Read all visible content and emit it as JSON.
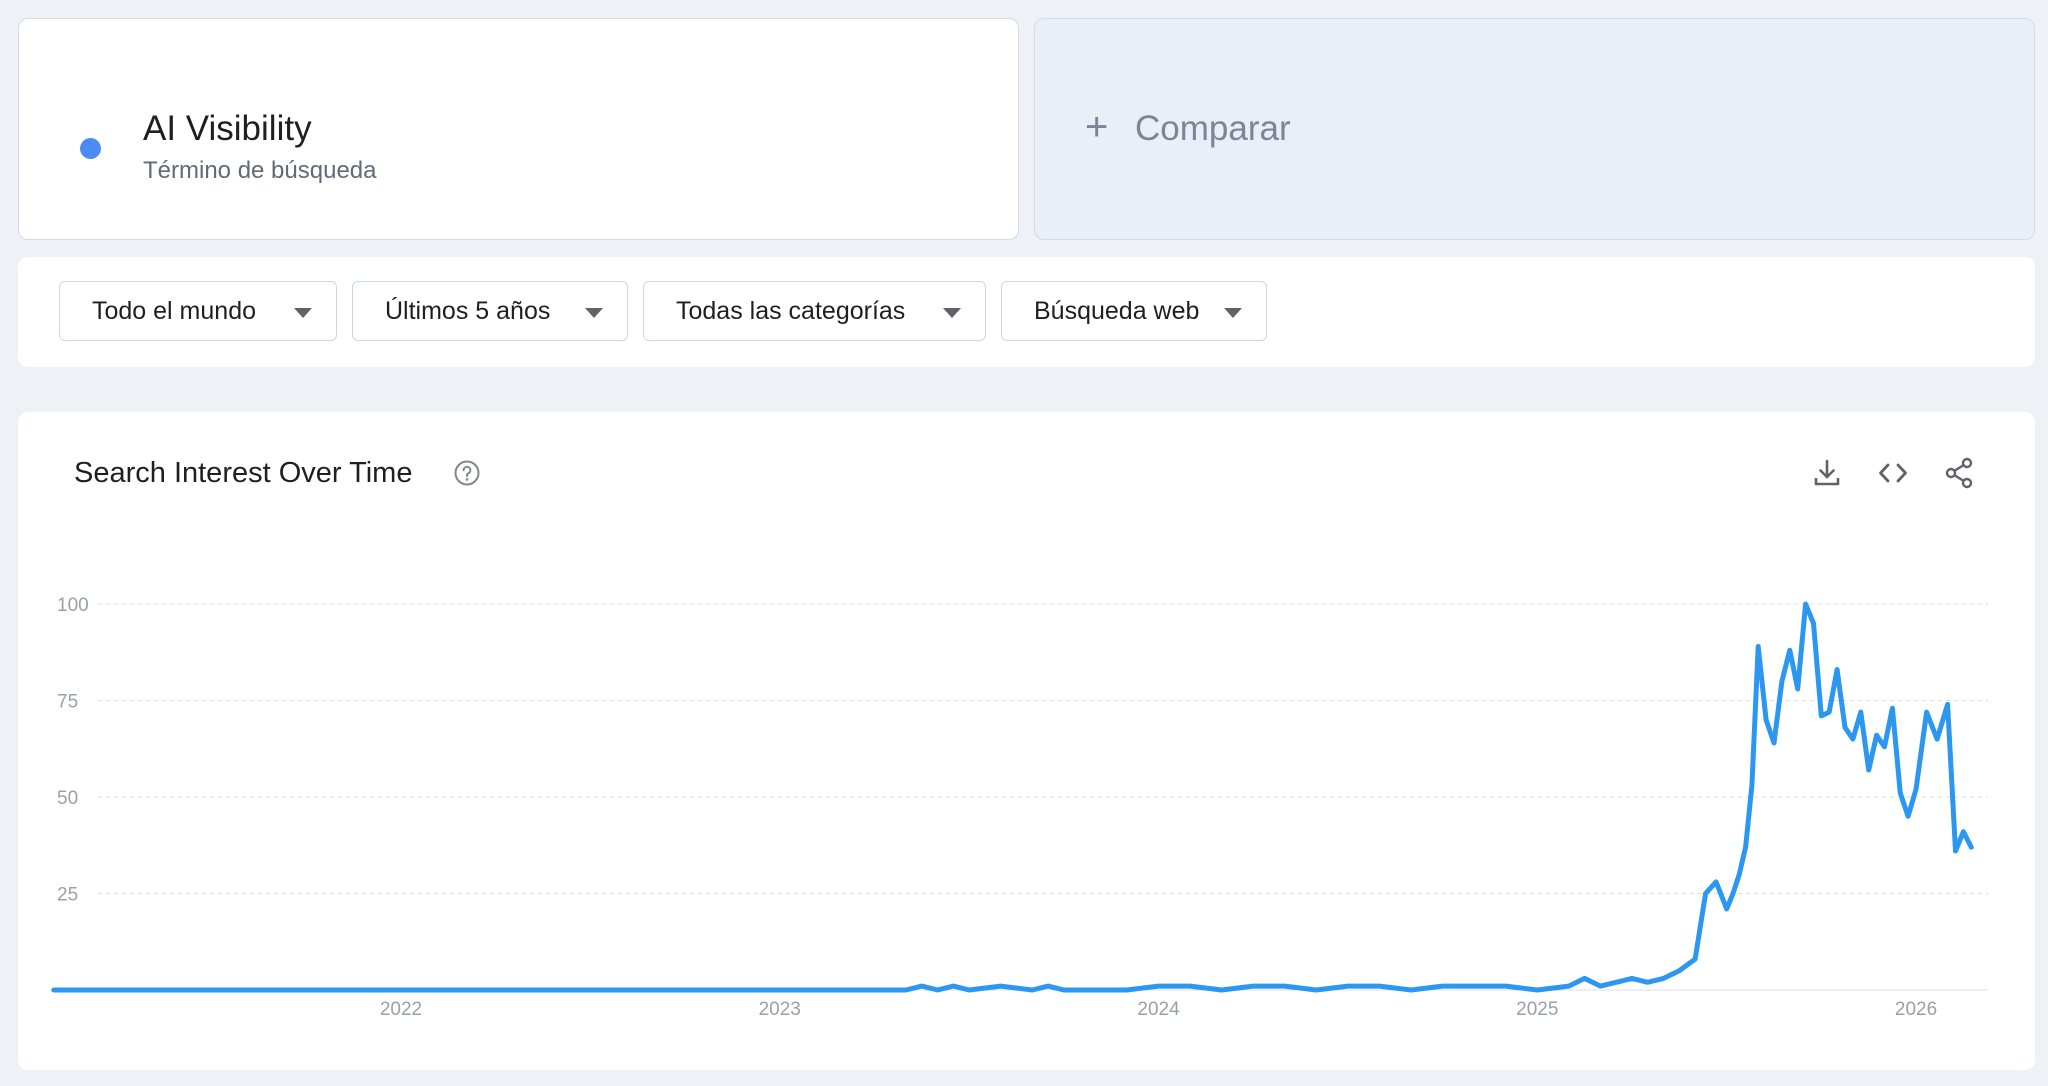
{
  "term": {
    "name": "AI Visibility",
    "subtitle": "Término de búsqueda",
    "color": "#4c8bf5"
  },
  "compare": {
    "plus": "+",
    "label": "Comparar"
  },
  "filters": [
    {
      "label": "Todo el mundo"
    },
    {
      "label": "Últimos 5 años"
    },
    {
      "label": "Todas las categorías"
    },
    {
      "label": "Búsqueda web"
    }
  ],
  "chart_card": {
    "title": "Search Interest Over Time",
    "help_icon": "help-circle-icon",
    "tools": [
      "download-icon",
      "embed-code-icon",
      "share-icon"
    ]
  },
  "chart_data": {
    "type": "line",
    "series": [
      {
        "color": "#2b97f0",
        "x": [
          "2021-02",
          "2021-06",
          "2022-01",
          "2022-06",
          "2023-01",
          "2023-05",
          "2023-05",
          "2023-06",
          "2023-06",
          "2023-07",
          "2023-08",
          "2023-09",
          "2023-09",
          "2023-10",
          "2023-12",
          "2024-01",
          "2024-01",
          "2024-02",
          "2024-03",
          "2024-04",
          "2024-05",
          "2024-06",
          "2024-07",
          "2024-08",
          "2024-09",
          "2024-10",
          "2024-11",
          "2024-12",
          "2025-01",
          "2025-02",
          "2025-02",
          "2025-03",
          "2025-03",
          "2025-04",
          "2025-04",
          "2025-05",
          "2025-05",
          "2025-06",
          "2025-06",
          "2025-06",
          "2025-07",
          "2025-07",
          "2025-07",
          "2025-07",
          "2025-07",
          "2025-08",
          "2025-08",
          "2025-08",
          "2025-08",
          "2025-09",
          "2025-09",
          "2025-09",
          "2025-09",
          "2025-10",
          "2025-10",
          "2025-10",
          "2025-10",
          "2025-11",
          "2025-11",
          "2025-11",
          "2025-11",
          "2025-12",
          "2025-12",
          "2025-12",
          "2025-12",
          "2026-01",
          "2026-01",
          "2026-01",
          "2026-02",
          "2026-02",
          "2026-02",
          "2026-02"
        ],
        "values": [
          0,
          0,
          0,
          0,
          0,
          0,
          1,
          0,
          1,
          0,
          1,
          0,
          1,
          0,
          0,
          1,
          1,
          1,
          0,
          1,
          1,
          0,
          1,
          1,
          0,
          1,
          1,
          1,
          0,
          1,
          3,
          1,
          2,
          3,
          2,
          3,
          5,
          8,
          25,
          28,
          21,
          25,
          30,
          37,
          53,
          89,
          70,
          64,
          80,
          88,
          78,
          100,
          95,
          71,
          72,
          83,
          68,
          65,
          72,
          57,
          66,
          63,
          73,
          51,
          45,
          52,
          72,
          65,
          74,
          36,
          41,
          37
        ]
      }
    ],
    "x_tick_labels": [
      "2022",
      "2023",
      "2024",
      "2025",
      "2026"
    ],
    "y_tick_labels": [
      "100",
      "75",
      "50",
      "25"
    ],
    "ylim": [
      0,
      100
    ],
    "grid": true,
    "legend": "none"
  }
}
